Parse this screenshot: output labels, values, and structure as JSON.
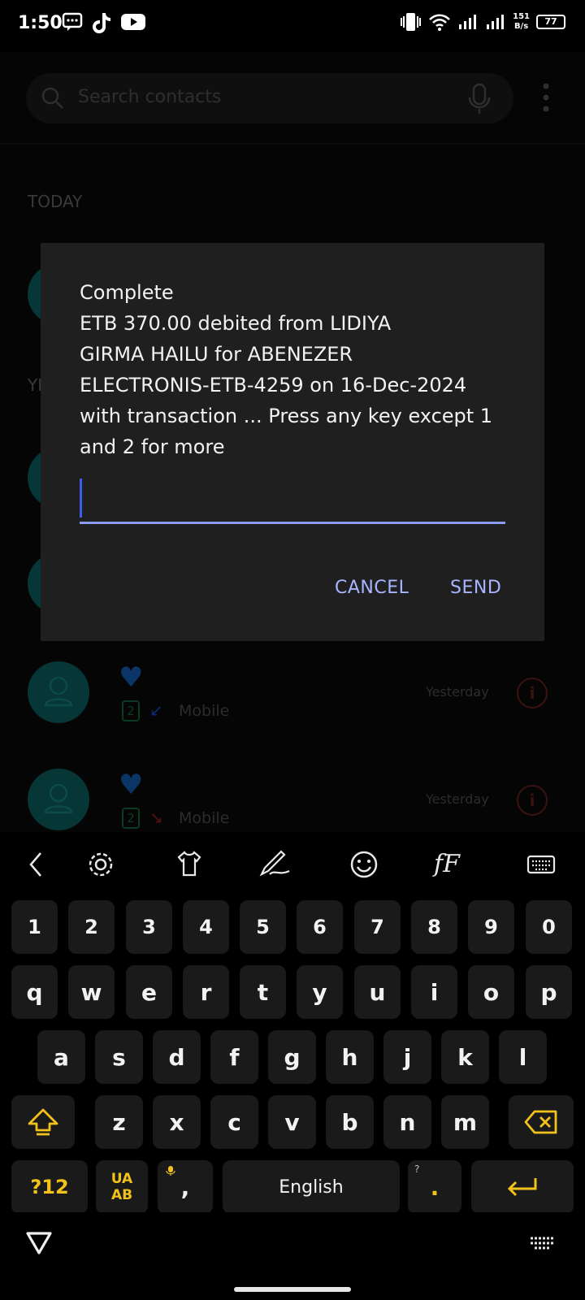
{
  "status_bar": {
    "time": "1:50",
    "speed_value": "151",
    "speed_unit": "B/s",
    "battery": "77"
  },
  "contacts_app": {
    "search_placeholder": "Search contacts",
    "section_today": "TODAY",
    "section_yesterday": "YE",
    "contacts": [
      {
        "type": "Mobile",
        "time": "Yesterday",
        "sim": "2",
        "arrow": "↙",
        "arrow_color": "#0a2a7a"
      },
      {
        "type": "Mobile",
        "time": "Yesterday",
        "sim": "2",
        "arrow": "↘",
        "arrow_color": "#5a1010"
      }
    ]
  },
  "dialog": {
    "message": "Complete\nETB 370.00 debited from LIDIYA\nGIRMA HAILU for ABENEZER\nELECTRONIS-ETB-4259 on 16-Dec-2024\nwith transaction ... Press any key except 1\nand 2 for more",
    "input_value": "",
    "cancel_label": "CANCEL",
    "send_label": "SEND"
  },
  "keyboard": {
    "toolbar_icons": [
      "back-icon",
      "settings-icon",
      "theme-icon",
      "handwriting-icon",
      "emoji-icon",
      "font-icon",
      "keyboard-layout-icon"
    ],
    "font_label": "fF",
    "number_row": [
      "1",
      "2",
      "3",
      "4",
      "5",
      "6",
      "7",
      "8",
      "9",
      "0"
    ],
    "row1": [
      "q",
      "w",
      "e",
      "r",
      "t",
      "y",
      "u",
      "i",
      "o",
      "p"
    ],
    "row2": [
      "a",
      "s",
      "d",
      "f",
      "g",
      "h",
      "j",
      "k",
      "l"
    ],
    "row3": [
      "z",
      "x",
      "c",
      "v",
      "b",
      "n",
      "m"
    ],
    "symbols_label": "?12",
    "lang_switch_top": "UA",
    "lang_switch_bottom": "AB",
    "comma": ",",
    "space_label": "English",
    "period": ".",
    "period_hint": "?",
    "accent_color": "#f2c21b"
  }
}
